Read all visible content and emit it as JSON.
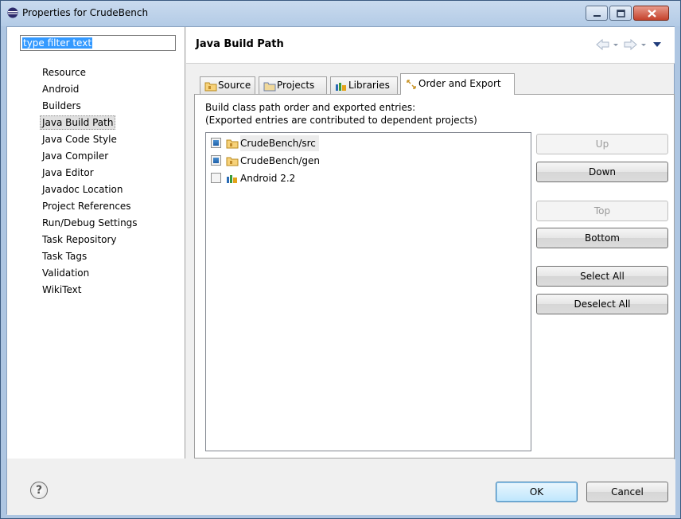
{
  "window": {
    "title": "Properties for CrudeBench"
  },
  "filter": {
    "value": "type filter text"
  },
  "sidebar": {
    "items": [
      {
        "label": "Resource"
      },
      {
        "label": "Android"
      },
      {
        "label": "Builders"
      },
      {
        "label": "Java Build Path",
        "selected": true
      },
      {
        "label": "Java Code Style"
      },
      {
        "label": "Java Compiler"
      },
      {
        "label": "Java Editor"
      },
      {
        "label": "Javadoc Location"
      },
      {
        "label": "Project References"
      },
      {
        "label": "Run/Debug Settings"
      },
      {
        "label": "Task Repository"
      },
      {
        "label": "Task Tags"
      },
      {
        "label": "Validation"
      },
      {
        "label": "WikiText"
      }
    ]
  },
  "page": {
    "title": "Java Build Path"
  },
  "tabs": [
    {
      "label": "Source",
      "icon": "source-folder-icon"
    },
    {
      "label": "Projects",
      "icon": "projects-icon"
    },
    {
      "label": "Libraries",
      "icon": "libraries-icon"
    },
    {
      "label": "Order and Export",
      "icon": "order-export-icon",
      "active": true
    }
  ],
  "order_export": {
    "description_line1": "Build class path order and exported entries:",
    "description_line2": "(Exported entries are contributed to dependent projects)",
    "entries": [
      {
        "label": "CrudeBench/src",
        "checked": true,
        "icon": "source-folder-icon"
      },
      {
        "label": "CrudeBench/gen",
        "checked": true,
        "icon": "source-folder-icon"
      },
      {
        "label": "Android 2.2",
        "checked": false,
        "icon": "library-icon"
      }
    ],
    "buttons": {
      "up": "Up",
      "down": "Down",
      "top": "Top",
      "bottom": "Bottom",
      "select_all": "Select All",
      "deselect_all": "Deselect All"
    }
  },
  "footer": {
    "help": "?",
    "ok": "OK",
    "cancel": "Cancel"
  },
  "colors": {
    "titlebar": "#b3cbe6",
    "selection": "#3399ff",
    "dialog_bg": "#f0f0f0"
  }
}
